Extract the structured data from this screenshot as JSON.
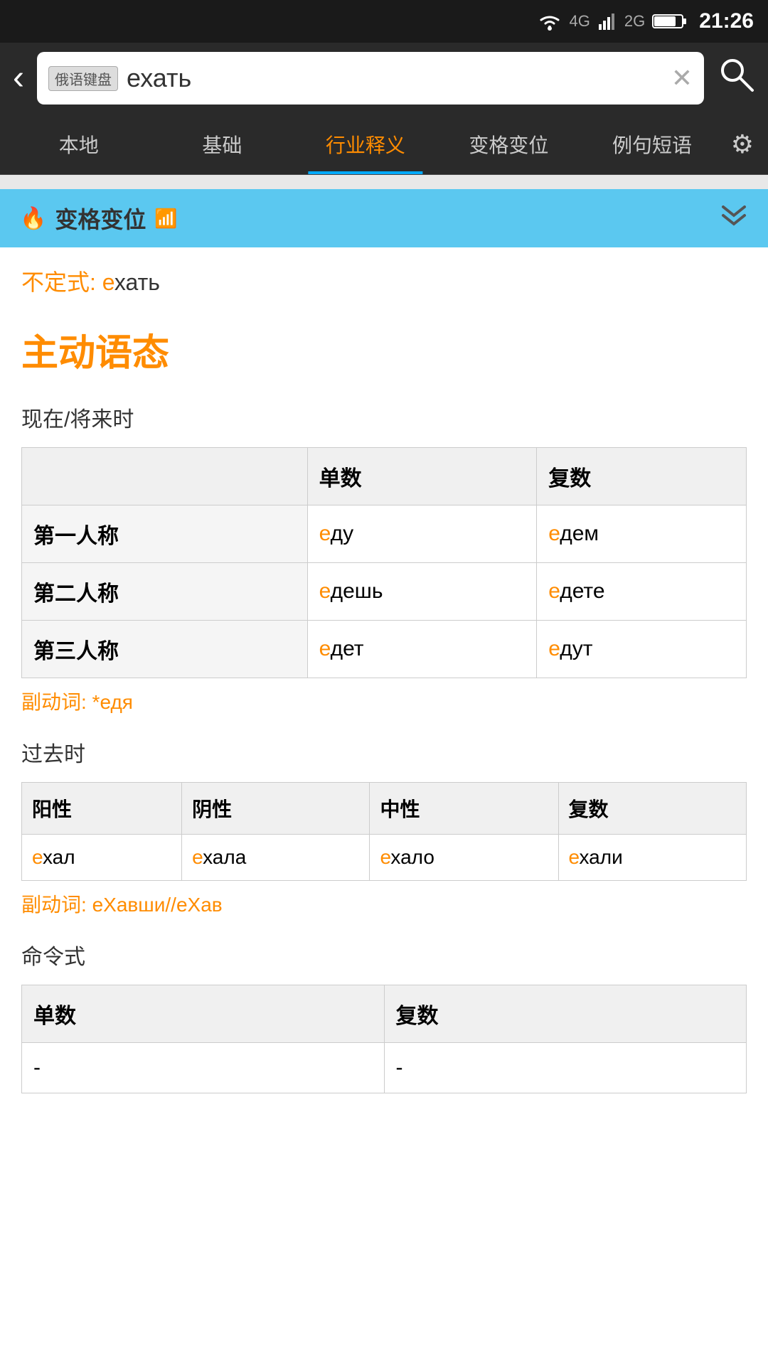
{
  "statusBar": {
    "time": "21:26",
    "icons": [
      "wifi",
      "4g",
      "2g",
      "sim",
      "battery"
    ]
  },
  "searchBar": {
    "backLabel": "‹",
    "kbdLabel": "俄语键盘",
    "searchValue": "ехать",
    "clearIcon": "✕",
    "searchIcon": "🔍"
  },
  "navTabs": [
    {
      "id": "local",
      "label": "本地"
    },
    {
      "id": "basic",
      "label": "基础"
    },
    {
      "id": "industry",
      "label": "行业释义",
      "active": true
    },
    {
      "id": "conjugation",
      "label": "变格变位"
    },
    {
      "id": "example",
      "label": "例句短语"
    }
  ],
  "settingsIcon": "⚙",
  "sectionHeader": {
    "title": "变格变位",
    "fireEmoji": "🔥",
    "wifiEmoji": "📶",
    "collapseIcon": "⌄⌄"
  },
  "infinitive": {
    "label": "不定式:",
    "prefix": "е",
    "rest": "хать"
  },
  "voiceTitle": "主动语态",
  "presentTense": {
    "label": "现在/将来时",
    "headers": [
      "",
      "单数",
      "复数"
    ],
    "rows": [
      {
        "person": "第一人称",
        "singular": {
          "accent": "е",
          "rest": "ду"
        },
        "plural": {
          "accent": "е",
          "rest": "дем"
        }
      },
      {
        "person": "第二人称",
        "singular": {
          "accent": "е",
          "rest": "дешь"
        },
        "plural": {
          "accent": "е",
          "rest": "дете"
        }
      },
      {
        "person": "第三人称",
        "singular": {
          "accent": "е",
          "rest": "дет"
        },
        "plural": {
          "accent": "е",
          "rest": "дут"
        }
      }
    ],
    "adverb": "副动词: *еДЯ"
  },
  "pastTense": {
    "label": "过去时",
    "headers": [
      "阳性",
      "阴性",
      "中性",
      "复数"
    ],
    "rows": [
      {
        "masc": {
          "accent": "е",
          "rest": "хал"
        },
        "fem": {
          "accent": "е",
          "rest": "хала"
        },
        "neut": {
          "accent": "е",
          "rest": "хало"
        },
        "plur": {
          "accent": "е",
          "rest": "хали"
        }
      }
    ],
    "adverb": "副动词: еХАВШИ//еХАВ"
  },
  "imperativeTense": {
    "label": "命令式",
    "headers": [
      "单数",
      "复数"
    ],
    "rows": [
      {
        "singular": "-",
        "plural": "-"
      }
    ]
  }
}
